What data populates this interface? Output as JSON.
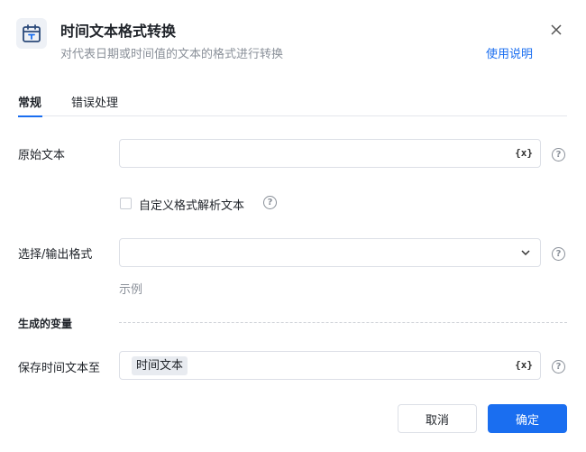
{
  "dialog": {
    "title": "时间文本格式转换",
    "subtitle": "对代表日期或时间值的文本的格式进行转换",
    "help_link": "使用说明",
    "icon": "calendar-icon",
    "close_icon": "close-icon"
  },
  "tabs": [
    {
      "label": "常规",
      "active": true
    },
    {
      "label": "错误处理",
      "active": false
    }
  ],
  "fields": {
    "source_text": {
      "label": "原始文本",
      "value": "",
      "var_icon": "{x}"
    },
    "custom_format": {
      "label": "自定义格式解析文本",
      "checked": false
    },
    "output_format": {
      "label": "选择/输出格式",
      "value": "",
      "example": "示例"
    },
    "section_title": "生成的变量",
    "save_to": {
      "label": "保存时间文本至",
      "tag": "时间文本",
      "var_icon": "{x}"
    }
  },
  "help_glyph": "?",
  "buttons": {
    "cancel": "取消",
    "ok": "确定"
  },
  "colors": {
    "accent": "#1a6ef0",
    "icon_bg": "#eef1f6"
  }
}
